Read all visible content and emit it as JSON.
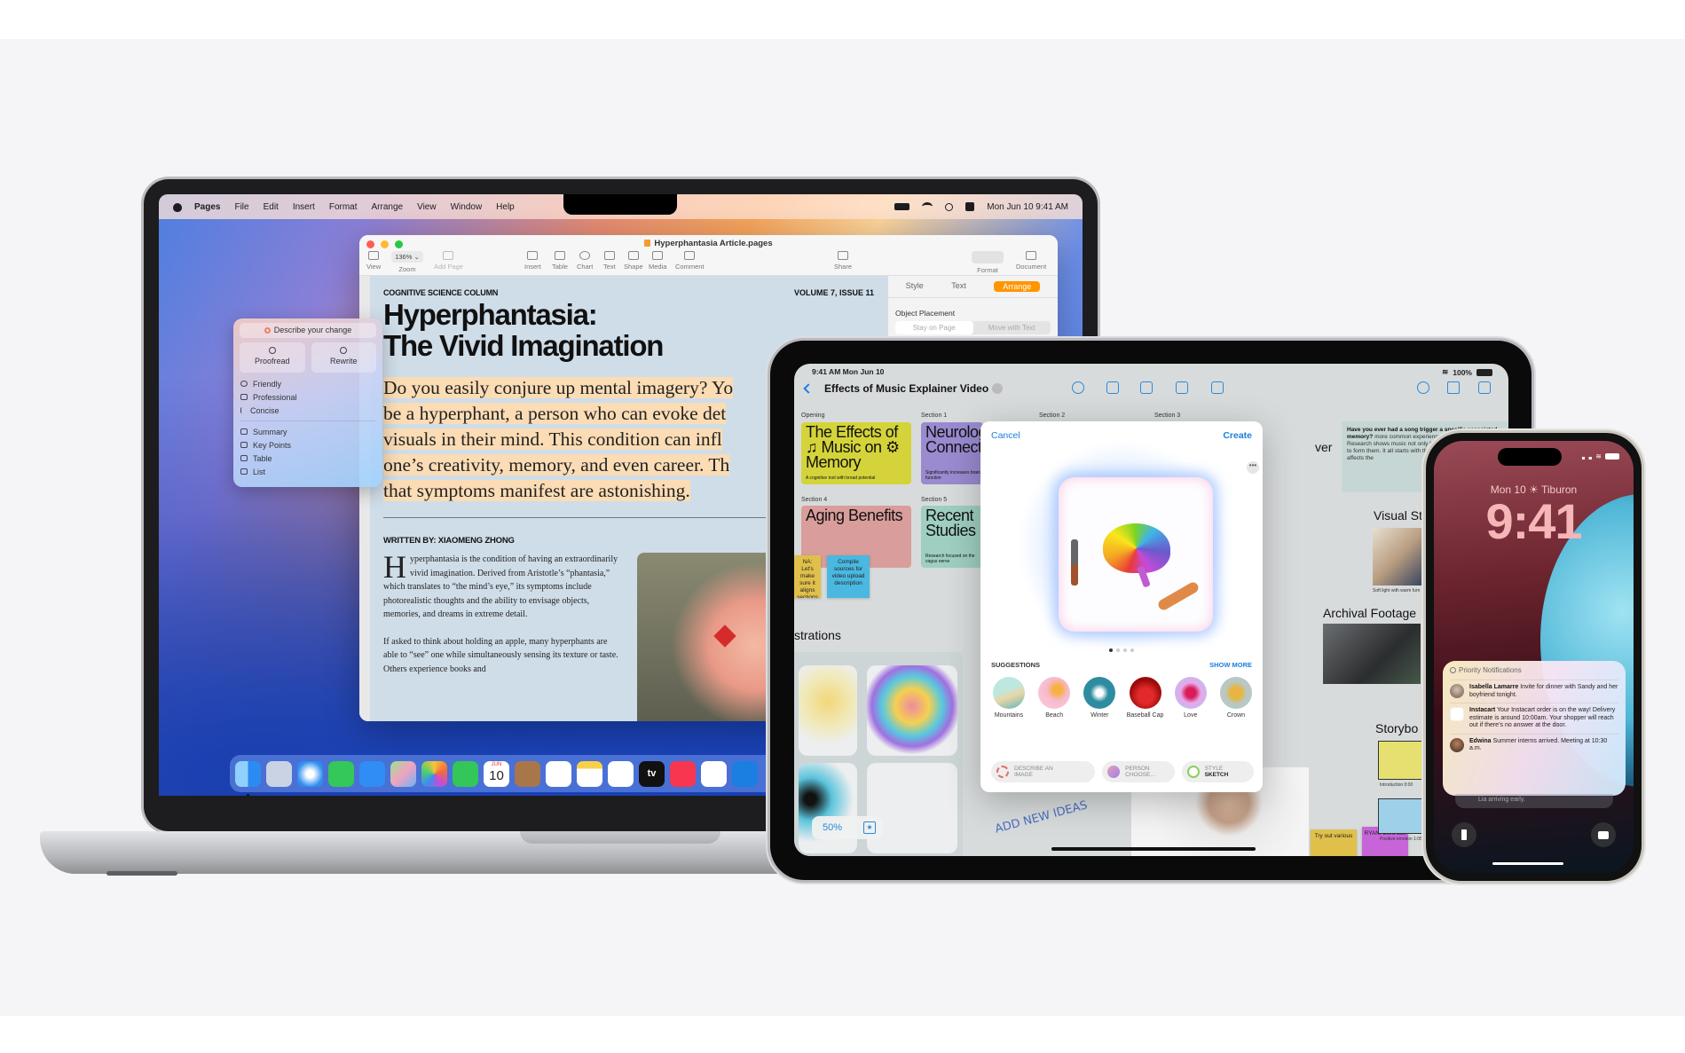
{
  "mac": {
    "menubar": {
      "items": [
        "Pages",
        "File",
        "Edit",
        "Insert",
        "Format",
        "Arrange",
        "View",
        "Window",
        "Help"
      ],
      "datetime": "Mon Jun 10  9:41 AM"
    },
    "window": {
      "title": "Hyperphantasia Article.pages",
      "toolbar": {
        "view": "View",
        "zoom_value": "136% ⌄",
        "zoom": "Zoom",
        "add_page": "Add Page",
        "insert": "Insert",
        "table": "Table",
        "chart": "Chart",
        "text": "Text",
        "shape": "Shape",
        "media": "Media",
        "comment": "Comment",
        "share": "Share",
        "format": "Format",
        "document": "Document"
      },
      "inspector": {
        "tabs": [
          "Style",
          "Text",
          "Arrange"
        ],
        "active_tab": "Arrange",
        "section": "Object Placement",
        "placement_options": [
          "Stay on Page",
          "Move with Text"
        ]
      },
      "document": {
        "column_label": "COGNITIVE SCIENCE COLUMN",
        "volume": "VOLUME 7, ISSUE 11",
        "headline_1": "Hyperphantasia:",
        "headline_2": "The Vivid Imagination",
        "lede": [
          "Do you easily conjure up mental imagery? Yo",
          "be a hyperphant, a person who can evoke det",
          "visuals in their mind. This condition can infl",
          "one’s creativity, memory, and even career. Th",
          "that symptoms manifest are astonishing."
        ],
        "byline": "WRITTEN BY: XIAOMENG ZHONG",
        "dropcap": "H",
        "para1": "yperphantasia is the condition of having an extraordinarily vivid imagination. Derived from Aristotle’s “phantasia,” which translates to “the mind’s eye,” its symptoms include photorealistic thoughts and the ability to envisage objects, memories, and dreams in extreme detail.",
        "para2": "If asked to think about holding an apple, many hyperphants are able to “see” one while simultaneously sensing its texture or taste. Others experience books and"
      }
    },
    "writing_tools": {
      "describe": "Describe your change",
      "proofread": "Proofread",
      "rewrite": "Rewrite",
      "tones": [
        "Friendly",
        "Professional",
        "Concise"
      ],
      "formats": [
        "Summary",
        "Key Points",
        "Table",
        "List"
      ]
    },
    "dock": {
      "apps": [
        "Finder",
        "Launchpad",
        "Safari",
        "Messages",
        "Mail",
        "Maps",
        "Photos",
        "FaceTime",
        "Calendar",
        "Contacts",
        "Reminders",
        "Notes",
        "Freeform",
        "TV",
        "Music",
        "News",
        "Keynote"
      ],
      "calendar_month": "JUN",
      "calendar_day": "10",
      "tv_label": "tv"
    }
  },
  "ipad": {
    "status_time": "9:41 AM   Mon Jun 10",
    "battery": "100%",
    "board_title": "Effects of Music Explainer Video",
    "sections": [
      "Opening",
      "Section 1",
      "Section 2",
      "Section 3",
      "Section 4",
      "Section 5"
    ],
    "cards": [
      {
        "title": "The Effects of ♫ Music on ⚙ Memory",
        "sub": "A cognitive tool with broad potential"
      },
      {
        "title": "Neurolog Connect",
        "sub": "Significantly increases brain function"
      },
      {
        "title": "Aging Benefits",
        "sub": ""
      },
      {
        "title": "Recent Studies",
        "sub": "Research focused on the vagus nerve"
      }
    ],
    "stickies": [
      "NA: Let's make sure it aligns sections",
      "Compile sources for video upload description",
      "Try out various",
      "RYAN: Let's use"
    ],
    "note": {
      "bold": "Have you ever had a song trigger a specific associated memory?",
      "text": "more common experience than you might think. Research shows music not only helps to recall memories but to form them. It all starts with the brain and the way music affects the"
    },
    "headings": {
      "ever": "ver",
      "visual_style": "Visual Sty",
      "visual_caption": "Soft light with warm furn",
      "archival": "Archival Footage",
      "storyboard": "Storybo",
      "illustrations": "strations",
      "sb1": "Introduction 0:00",
      "sb2": "Positive emotion 1:05"
    },
    "zoom_level": "50%",
    "handwriting": "ADD NEW IDEAS",
    "image_playground": {
      "cancel": "Cancel",
      "create": "Create",
      "more": "•••",
      "page_index": 1,
      "page_count": 4,
      "suggestions_label": "SUGGESTIONS",
      "show_more": "SHOW MORE",
      "suggestions": [
        "Mountains",
        "Beach",
        "Winter",
        "Baseball Cap",
        "Love",
        "Crown"
      ],
      "describe_line1": "DESCRIBE AN",
      "describe_line2": "IMAGE",
      "person_line1": "PERSON",
      "person_line2": "CHOOSE...",
      "style_line1": "STYLE",
      "style_line2": "SKETCH"
    }
  },
  "iphone": {
    "date_line": "Mon 10  ☀ Tiburon",
    "time": "9:41",
    "notifications_title": "Priority Notifications",
    "notifications": [
      {
        "sender": "Isabella Lamarre",
        "text": "Invite for dinner with Sandy and her boyfriend tonight."
      },
      {
        "sender": "Instacart",
        "text": "Your Instacart order is on the way! Delivery estimate is around 10:00am. Your shopper will reach out if there’s no answer at the door."
      },
      {
        "sender": "Edwina",
        "text": "Summer interns arrived. Meeting at 10:30 a.m."
      }
    ],
    "stacked": "Lia arriving early."
  }
}
